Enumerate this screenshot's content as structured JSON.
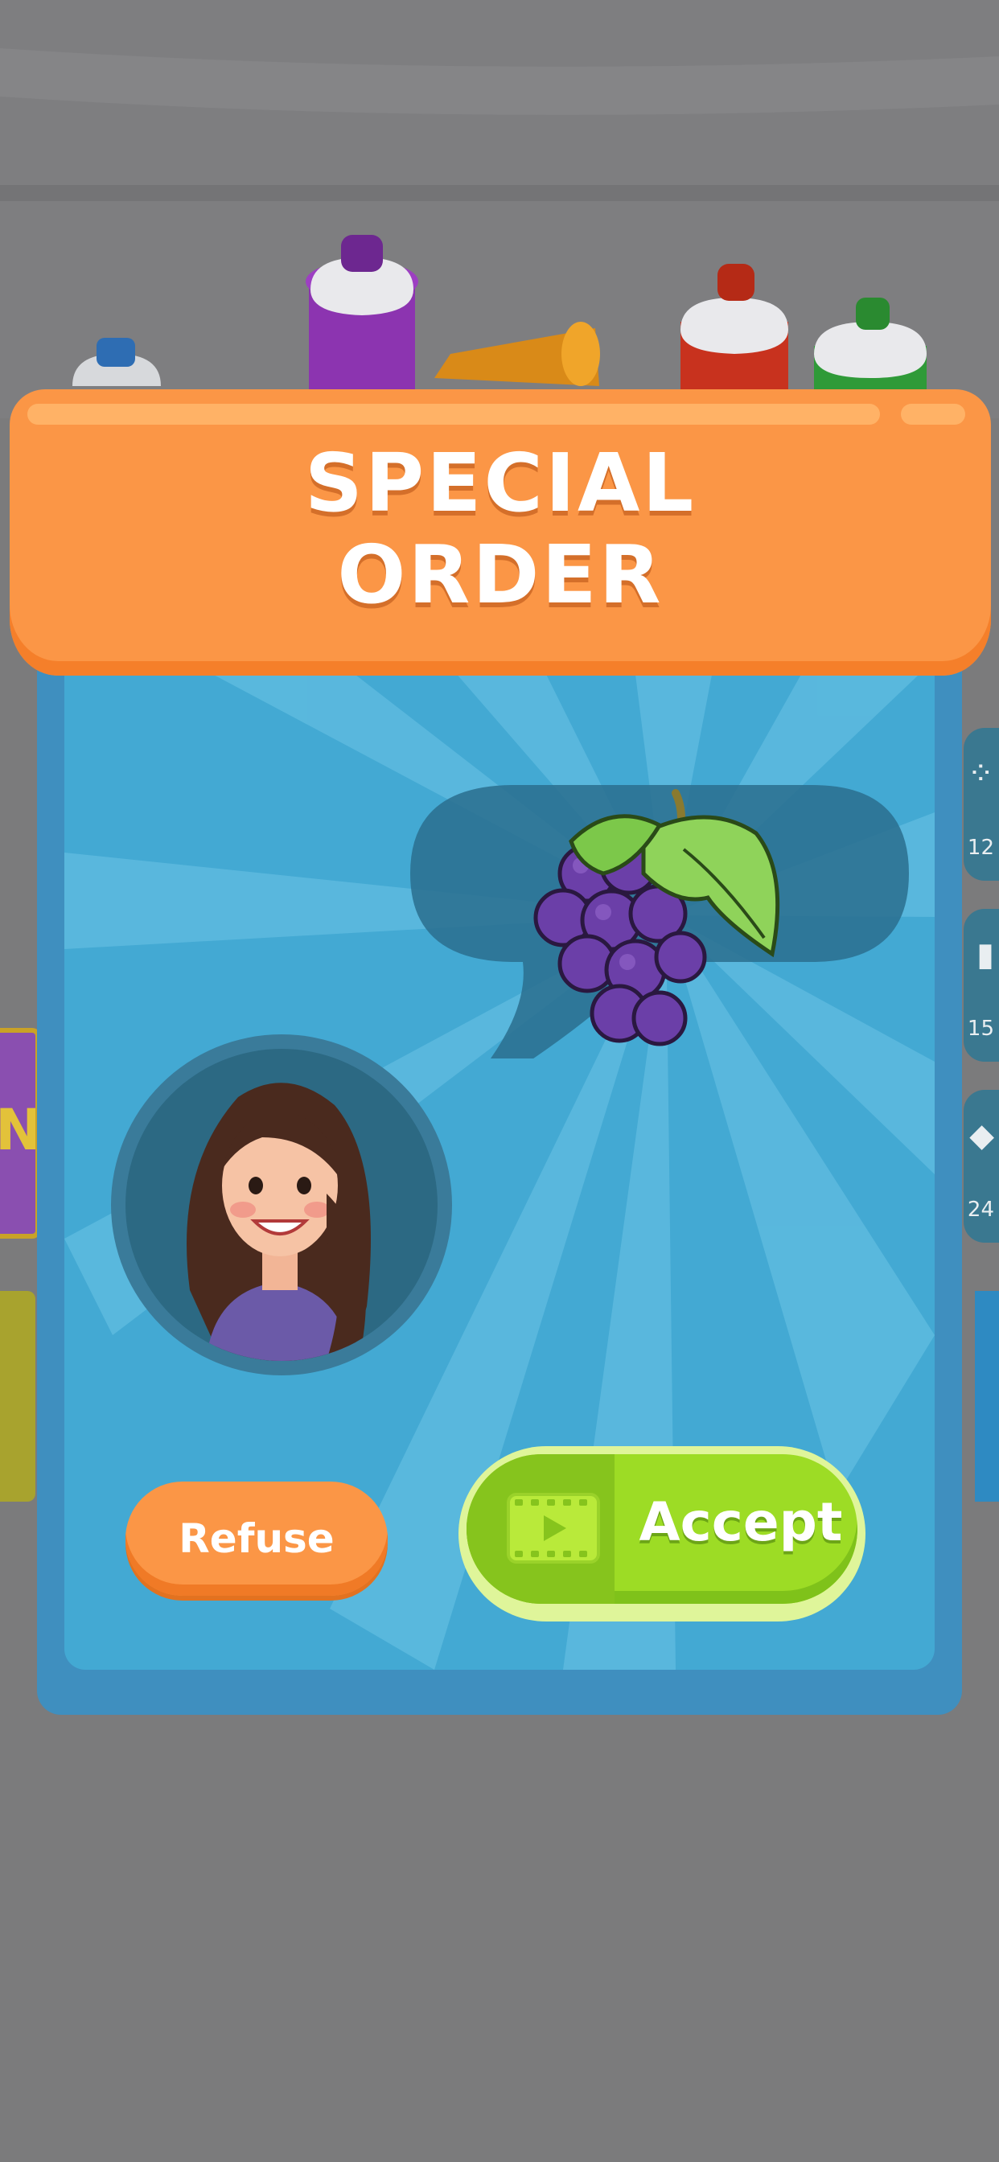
{
  "header": {
    "title_line1": "SPECIAL",
    "title_line2": "ORDER"
  },
  "order": {
    "item_icon": "grapes-icon",
    "customer_icon": "woman-customer-avatar"
  },
  "buttons": {
    "refuse_label": "Refuse",
    "accept_label": "Accept",
    "accept_icon": "video-ad-icon"
  },
  "side_tabs": {
    "tab1_count": "12",
    "tab2_count": "15",
    "tab3_count": "24"
  },
  "colors": {
    "header": "#fb9646",
    "panel": "#43a9d3",
    "accept": "#9ddc25",
    "refuse": "#fb9646"
  }
}
